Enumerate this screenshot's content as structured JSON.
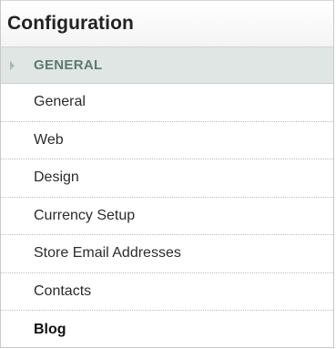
{
  "panel": {
    "title": "Configuration"
  },
  "section": {
    "label": "GENERAL",
    "icon": "triangle-right-icon"
  },
  "nav": {
    "items": [
      {
        "label": "General"
      },
      {
        "label": "Web"
      },
      {
        "label": "Design"
      },
      {
        "label": "Currency Setup"
      },
      {
        "label": "Store Email Addresses"
      },
      {
        "label": "Contacts"
      },
      {
        "label": "Blog"
      }
    ],
    "active_item": "Blog"
  },
  "colors": {
    "section_background": "#dfe6e4",
    "section_text": "#5d7a6f",
    "border": "#c9c9c9"
  }
}
